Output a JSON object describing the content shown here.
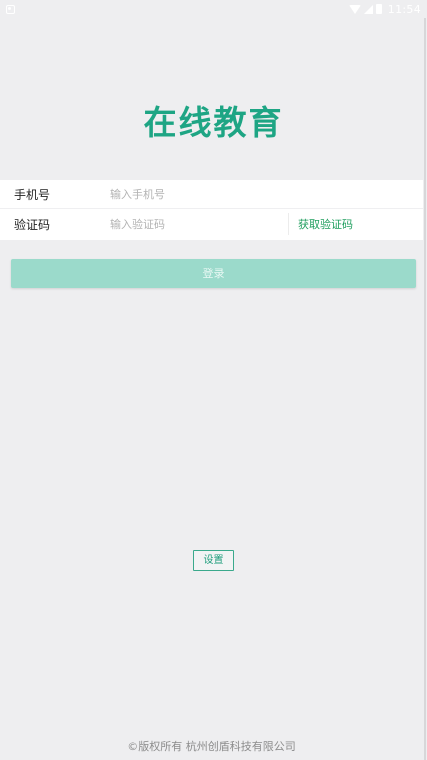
{
  "status_bar": {
    "time": "11:54",
    "icons": [
      "notification-icon",
      "wifi-icon",
      "signal-icon",
      "battery-icon"
    ]
  },
  "app": {
    "title": "在线教育"
  },
  "form": {
    "phone": {
      "label": "手机号",
      "placeholder": "输入手机号",
      "value": ""
    },
    "code": {
      "label": "验证码",
      "placeholder": "输入验证码",
      "value": "",
      "get_code_label": "获取验证码"
    }
  },
  "login": {
    "label": "登录"
  },
  "settings": {
    "label": "设置"
  },
  "footer": {
    "copyright": "©版权所有    杭州创盾科技有限公司"
  },
  "colors": {
    "background": "#eeeef0",
    "brand_green": "#1ea584",
    "login_disabled": "#9bdacb",
    "link_green": "#1f9e5e"
  }
}
